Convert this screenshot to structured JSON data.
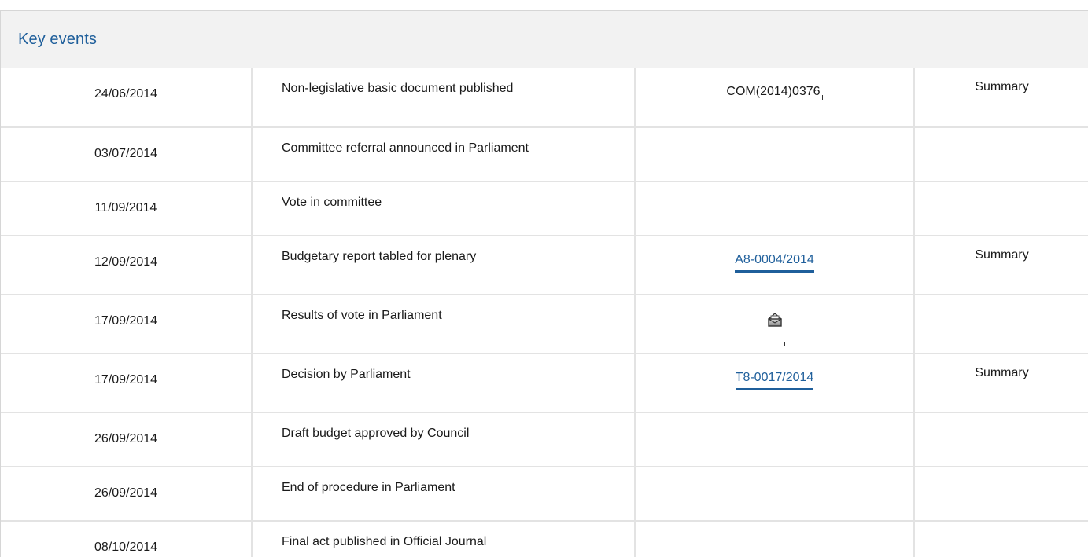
{
  "panel": {
    "title": "Key events"
  },
  "events": [
    {
      "date": "24/06/2014",
      "event": "Non-legislative basic document published",
      "reference": "COM(2014)0376",
      "reference_type": "text",
      "summary": "Summary"
    },
    {
      "date": "03/07/2014",
      "event": "Committee referral announced in Parliament",
      "reference": "",
      "reference_type": "none",
      "summary": ""
    },
    {
      "date": "11/09/2014",
      "event": "Vote in committee",
      "reference": "",
      "reference_type": "none",
      "summary": ""
    },
    {
      "date": "12/09/2014",
      "event": "Budgetary report tabled for plenary",
      "reference": "A8-0004/2014",
      "reference_type": "link",
      "summary": "Summary"
    },
    {
      "date": "17/09/2014",
      "event": "Results of vote in Parliament",
      "reference": "",
      "reference_type": "icon",
      "reference_icon": "ballot-box-icon",
      "summary": ""
    },
    {
      "date": "17/09/2014",
      "event": "Decision by Parliament",
      "reference": "T8-0017/2014",
      "reference_type": "link",
      "summary": "Summary"
    },
    {
      "date": "26/09/2014",
      "event": "Draft budget approved by Council",
      "reference": "",
      "reference_type": "none",
      "summary": ""
    },
    {
      "date": "26/09/2014",
      "event": "End of procedure in Parliament",
      "reference": "",
      "reference_type": "none",
      "summary": ""
    },
    {
      "date": "08/10/2014",
      "event": "Final act published in Official Journal",
      "reference": "",
      "reference_type": "none",
      "summary": ""
    }
  ],
  "colors": {
    "title": "#1f5f9b",
    "link": "#1f5f9b",
    "header_bg": "#f2f2f2",
    "grid": "#e3e3e3"
  }
}
